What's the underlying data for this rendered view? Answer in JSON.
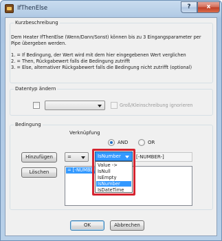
{
  "window": {
    "title": "IfThenElse",
    "help_label": "?",
    "close_label": "x"
  },
  "kurz": {
    "legend": "Kurzbeschreibung",
    "lines": [
      "Dem Heater IfThenElse (Wenn/Dann/Sonst) können bis zu 3 Eingangsparameter per",
      "Pipe übergeben werden.",
      "1. = If Bedingung, der Wert wird mit dem hier eingegebenen Wert verglichen",
      "2. = Then, Rückgabewert falls die Bedingung zutrifft",
      "3. = Else, alternativer Rückgabewert falls die Bedingung nicht zutrifft (optional)"
    ]
  },
  "datentyp": {
    "legend": "Datentyp ändern",
    "dropdown_value": "",
    "case_label": "Groß/Kleinschreibung ignorieren"
  },
  "bedingung": {
    "legend": "Bedingung",
    "verknuepfung_label": "Verknüpfung",
    "and_label": "AND",
    "or_label": "OR",
    "and_checked": true,
    "hinzufuegen_label": "Hinzufügen",
    "loeschen_label": "Löschen",
    "operator_value": "=",
    "function_value": "IsNumber",
    "param_value": "[-NUMBER-]",
    "list_items": [
      "= [-NUMBER-]"
    ],
    "function_options": [
      {
        "label": "Value ->",
        "highlighted": false
      },
      {
        "label": "IsNull",
        "highlighted": false
      },
      {
        "label": "IsEmpty",
        "highlighted": false
      },
      {
        "label": "IsNumber",
        "highlighted": true
      },
      {
        "label": "IsDateTime",
        "highlighted": false
      }
    ]
  },
  "buttons": {
    "ok_label": "OK",
    "cancel_label": "Abbrechen"
  }
}
